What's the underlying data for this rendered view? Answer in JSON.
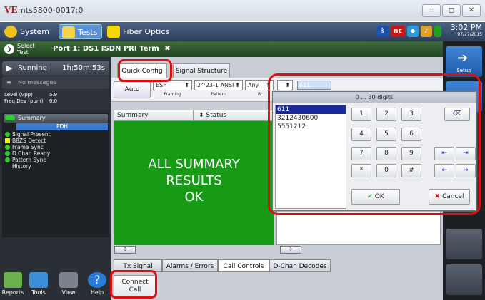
{
  "window": {
    "title": "mts5800-0017:0",
    "logo": "VE"
  },
  "menubar": {
    "items": [
      {
        "label": "System",
        "icon": "gear-icon"
      },
      {
        "label": "Tests",
        "icon": "test-icon"
      },
      {
        "label": "Fiber Optics",
        "icon": "fiber-icon"
      }
    ],
    "tray_nc": "nc",
    "time": "3:02 PM",
    "date": "07/27/2015"
  },
  "portbar": {
    "select_line1": "Select",
    "select_line2": "Test",
    "tab_label": "Port 1: DS1 ISDN PRI Term"
  },
  "status": {
    "running": "Running",
    "elapsed": "1h:50m:53s",
    "messages": "No messages",
    "level_label": "Level (Vpp)",
    "level_value": "5.9",
    "freq_label": "Freq Dev (ppm)",
    "freq_value": "0.0"
  },
  "summary_tree": {
    "header": "Summary",
    "pdh": "PDH",
    "items": [
      "Signal Present",
      "B8ZS Detect",
      "Frame Sync",
      "D Chan Ready",
      "Pattern Sync"
    ],
    "history": "History"
  },
  "tools": [
    {
      "label": "Reports"
    },
    {
      "label": "Tools"
    },
    {
      "label": "View"
    },
    {
      "label": "Help"
    }
  ],
  "right_strip": {
    "setup_label": "Setup"
  },
  "tabs_top": [
    {
      "label": "Quick Config",
      "active": true
    },
    {
      "label": "Signal Structure",
      "active": false
    }
  ],
  "quick_config": {
    "auto_label": "Auto",
    "framing_value": "ESF",
    "framing_label": "Framing",
    "pattern_value": "2^23-1 ANSI",
    "pattern_label": "Pattern",
    "b_value": "Any",
    "b_label": "B",
    "number_value": "611"
  },
  "panes": {
    "left_header": "Summary",
    "right_header": "Status",
    "summary_line1": "ALL SUMMARY",
    "summary_line2": "RESULTS",
    "summary_line3": "OK"
  },
  "tabs_bottom": [
    {
      "label": "Tx Signal",
      "active": false
    },
    {
      "label": "Alarms / Errors",
      "active": false
    },
    {
      "label": "Call Controls",
      "active": true
    },
    {
      "label": "D-Chan Decodes",
      "active": false
    }
  ],
  "connect_call": {
    "line1": "Connect",
    "line2": "Call"
  },
  "keypad": {
    "header": "0 ... 30 digits",
    "list": [
      "611",
      "3212430600",
      "5551212"
    ],
    "keys": [
      "1",
      "2",
      "3",
      "4",
      "5",
      "6",
      "7",
      "8",
      "9",
      "*",
      "0",
      "#"
    ],
    "ok_label": "OK",
    "cancel_label": "Cancel"
  },
  "colors": {
    "summary_ok": "#179b17",
    "highlight": "#e01010",
    "list_selected": "#1a2a9a"
  }
}
